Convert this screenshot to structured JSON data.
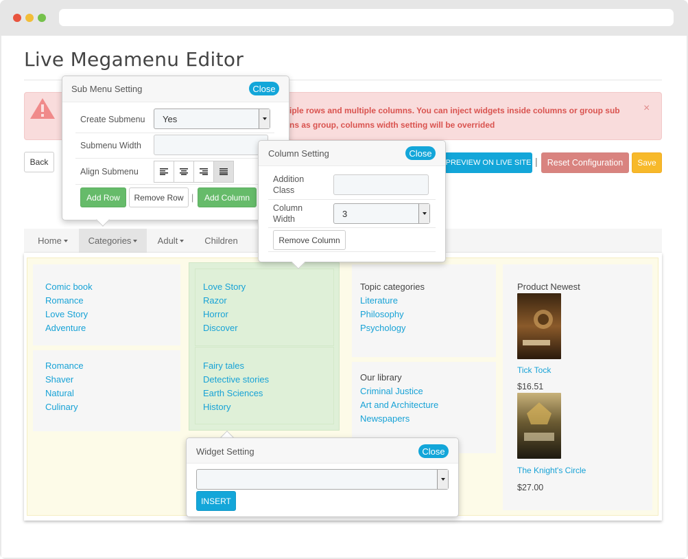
{
  "page": {
    "title": "Live Megamenu Editor"
  },
  "alert": {
    "text_line1": "iple rows and multiple columns. You can inject widgets inside columns or group sub",
    "text_line2": "ns as group, columns width setting will be overrided",
    "close": "×"
  },
  "toolbar": {
    "back": "Back",
    "preview": "PREVIEW ON LIVE SITE",
    "separator": "|",
    "reset": "Reset Configuration",
    "save": "Save"
  },
  "nav": {
    "items": [
      {
        "label": "Home",
        "dropdown": true
      },
      {
        "label": "Categories",
        "dropdown": true,
        "active": true
      },
      {
        "label": "Adult",
        "dropdown": true
      },
      {
        "label": "Children",
        "dropdown": false
      }
    ]
  },
  "menu": {
    "col1_group1": [
      "Comic book",
      "Romance",
      "Love Story",
      "Adventure"
    ],
    "col1_group2": [
      "Romance",
      "Shaver",
      "Natural",
      "Culinary"
    ],
    "col2_group1": [
      "Love Story",
      "Razor",
      "Horror",
      "Discover"
    ],
    "col2_group2": [
      "Fairy tales",
      "Detective stories",
      "Earth Sciences",
      "History"
    ],
    "col3_group1": {
      "heading": "Topic categories",
      "links": [
        "Literature",
        "Philosophy",
        "Psychology"
      ]
    },
    "col3_group2": {
      "heading": "Our library",
      "links": [
        "Criminal Justice",
        "Art and Architecture",
        "Newspapers"
      ]
    },
    "col4": {
      "heading": "Product Newest",
      "products": [
        {
          "name": "Tick Tock",
          "price": "$16.51"
        },
        {
          "name": "The Knight's Circle",
          "price": "$27.00"
        }
      ]
    }
  },
  "submenu_popover": {
    "title": "Sub Menu Setting",
    "close": "Close",
    "create_label": "Create Submenu",
    "create_value": "Yes",
    "width_label": "Submenu Width",
    "width_value": "",
    "align_label": "Align Submenu",
    "add_row": "Add Row",
    "remove_row": "Remove Row",
    "separator": "|",
    "add_column": "Add Column"
  },
  "column_popover": {
    "title": "Column Setting",
    "close": "Close",
    "class_label_1": "Addition",
    "class_label_2": "Class",
    "class_value": "",
    "width_label_1": "Column",
    "width_label_2": "Width",
    "width_value": "3",
    "remove_column": "Remove Column"
  },
  "widget_popover": {
    "title": "Widget Setting",
    "close": "Close",
    "select_value": "",
    "insert": "INSERT"
  },
  "colors": {
    "accent_blue": "#13a6d9",
    "green_button": "#66bb6a",
    "reset_red": "#d9837f",
    "save_yellow": "#f7b92a",
    "alert_bg": "#f9dcdc",
    "selected_column": "#dff0d8"
  }
}
